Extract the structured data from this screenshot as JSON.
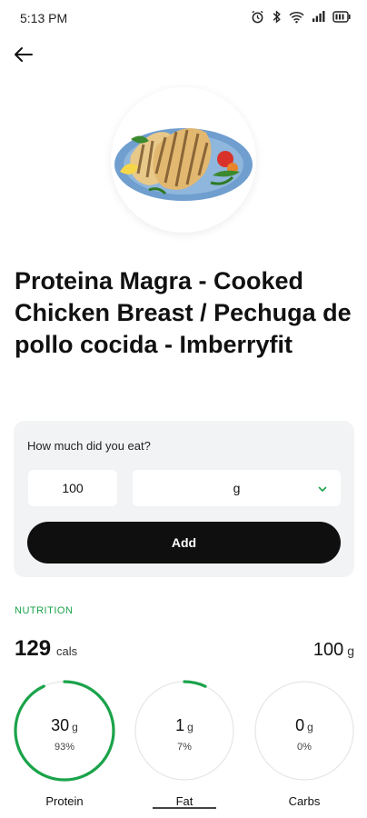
{
  "status_bar": {
    "time": "5:13 PM",
    "icons": [
      "alarm-icon",
      "bluetooth-icon",
      "wifi-icon",
      "signal-icon",
      "battery-icon"
    ]
  },
  "header": {
    "back_icon": "arrow-left-icon"
  },
  "food": {
    "title": "Proteina Magra - Cooked Chicken Breast / Pechuga de pollo cocida - Imberryfit"
  },
  "portion": {
    "question": "How much did you eat?",
    "quantity_value": "100",
    "unit_selected": "g",
    "add_label": "Add"
  },
  "nutrition": {
    "heading": "NUTRITION",
    "calories": "129",
    "calories_unit": "cals",
    "serving_amount": "100",
    "serving_unit": "g",
    "accent_color": "#1aa34a",
    "macros": [
      {
        "name": "Protein",
        "amount": "30",
        "unit": "g",
        "percent_label": "93%",
        "percent": 0.93
      },
      {
        "name": "Fat",
        "amount": "1",
        "unit": "g",
        "percent_label": "7%",
        "percent": 0.07
      },
      {
        "name": "Carbs",
        "amount": "0",
        "unit": "g",
        "percent_label": "0%",
        "percent": 0.0
      }
    ]
  }
}
